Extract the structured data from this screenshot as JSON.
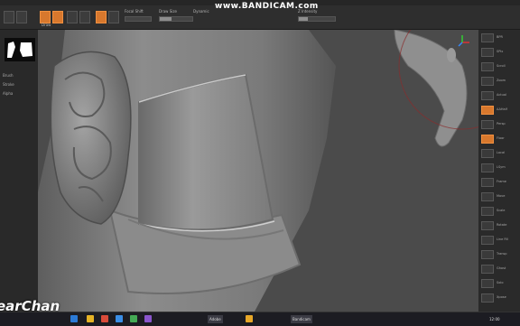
{
  "watermark": "www.BANDICAM.com",
  "channel": "earChan",
  "app": {
    "toolbar_labels": [
      "Draw",
      "Move",
      "Scale",
      "Rotate",
      "Focal Shift",
      "Draw Size",
      "Dynamic",
      "Z Intensity"
    ]
  },
  "left_panel": {
    "labels": [
      "Brush",
      "Stroke",
      "Alpha"
    ]
  },
  "right_panel": {
    "labels": [
      "BPR",
      "SPix",
      "Scroll",
      "Zoom",
      "Actual",
      "AAHalf",
      "Persp",
      "Floor",
      "Local",
      "LSym",
      "Frame",
      "Move",
      "Scale",
      "Rotate",
      "Line Fill",
      "Transp",
      "Ghost",
      "Solo",
      "Xpose"
    ]
  },
  "taskbar": {
    "items": [
      "Adobe",
      "Bandicam"
    ],
    "clock": "12:00"
  },
  "colors": {
    "accent": "#d8782d",
    "model": "#8a8a8a",
    "background": "#4a4a4a"
  }
}
